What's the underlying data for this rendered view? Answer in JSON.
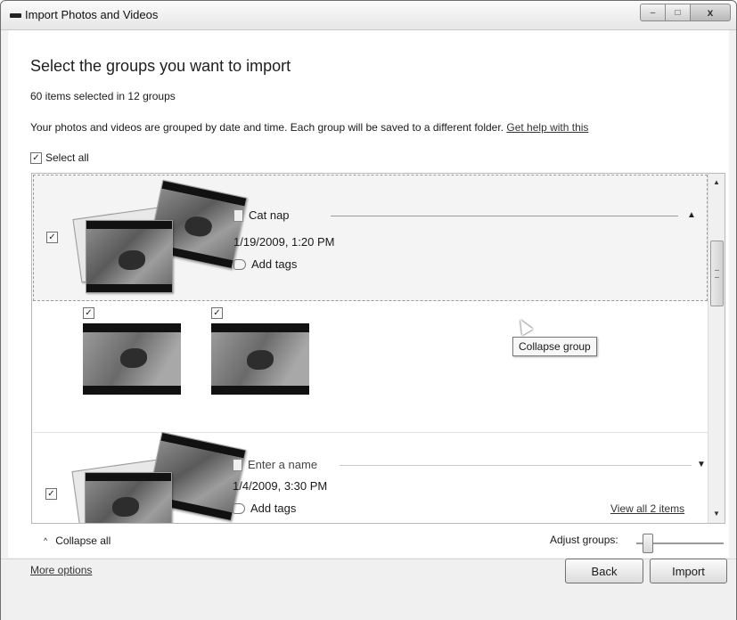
{
  "window": {
    "title": "Import Photos and Videos",
    "controls": {
      "minimize": "–",
      "maximize": "□",
      "close": "x"
    }
  },
  "main": {
    "heading": "Select the groups you want to import",
    "count_text": "60 items selected in 12 groups",
    "description": "Your photos and videos are grouped by date and time. Each group will be saved to a different folder.",
    "help_link": "Get help with this",
    "select_all": {
      "label": "Select all",
      "checked": true
    }
  },
  "groups": [
    {
      "checked": true,
      "name": "Cat nap",
      "date": "1/19/2009, 1:20 PM",
      "tags_label": "Add tags",
      "expanded": true,
      "items": [
        {
          "checked": true
        },
        {
          "checked": true
        }
      ]
    },
    {
      "checked": true,
      "name_placeholder": "Enter a name",
      "date": "1/4/2009, 3:30 PM",
      "tags_label": "Add tags",
      "view_all_label": "View all 2 items",
      "expanded": false
    }
  ],
  "tooltip": "Collapse group",
  "bottom": {
    "collapse_all": "Collapse all",
    "adjust_groups_label": "Adjust groups:"
  },
  "footer": {
    "more_options": "More options",
    "back": "Back",
    "import": "Import"
  },
  "icons": {
    "check": "✓",
    "expand_up": "▲",
    "expand_down": "▼",
    "chevron_up": "^"
  }
}
